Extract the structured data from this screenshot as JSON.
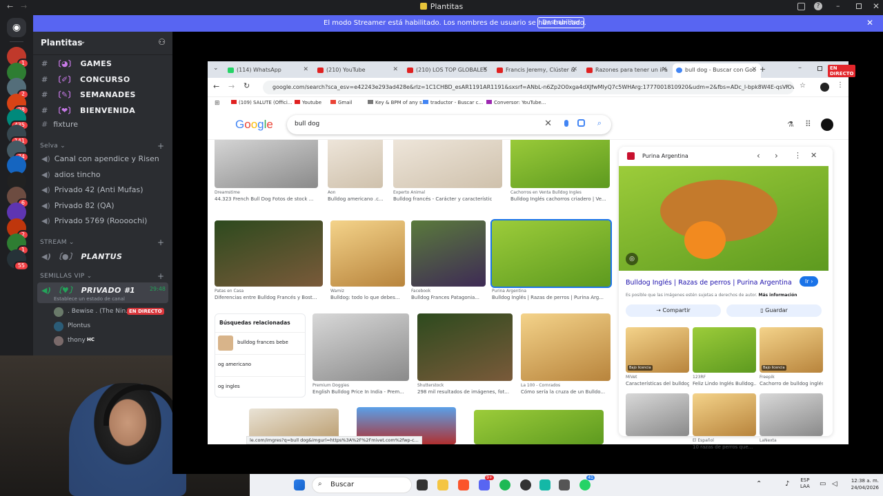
{
  "window": {
    "title": "Plantitas"
  },
  "banner": {
    "text": "El modo Streamer está habilitado. Los nombres de usuario se han truncado.",
    "button": "Deshabilitar"
  },
  "servers": [
    {
      "badge": "1"
    },
    {
      "badge": ""
    },
    {
      "badge": "2"
    },
    {
      "badge": "28"
    },
    {
      "badge": "435"
    },
    {
      "badge": "141"
    },
    {
      "badge": "74"
    },
    {
      "badge": ""
    },
    {
      "badge": ""
    },
    {
      "badge": "6"
    },
    {
      "badge": ""
    },
    {
      "badge": "2"
    },
    {
      "badge": "1"
    },
    {
      "badge": "55"
    }
  ],
  "server_name": "Plantitas",
  "channels": {
    "top": [
      {
        "name": "GAMES"
      },
      {
        "name": "CONCURSO"
      },
      {
        "name": "SEMANADES"
      },
      {
        "name": "BIENVENIDA"
      },
      {
        "name": "fixture"
      }
    ],
    "selva_label": "Selva",
    "selva": [
      {
        "name": "Canal con apendice y Risen"
      },
      {
        "name": "adios tincho"
      },
      {
        "name": "Privado 42 (Anti Mufas)"
      },
      {
        "name": "Privado 82 (QA)"
      },
      {
        "name": "Privado 5769 (Roooochi)"
      }
    ],
    "stream_label": "STREAM",
    "stream": [
      {
        "name": "PLANTUS"
      }
    ],
    "vip_label": "SEMILLAS VIP",
    "voice": {
      "name": "PRIVADO #1",
      "time": "29:48",
      "status": "Establece un estado de canal"
    },
    "users": [
      {
        "name": ". Bewise . (The Nin...",
        "live": "EN DIRECTO"
      },
      {
        "name": "Plontus",
        "live": ""
      },
      {
        "name": "thony",
        "live": "HC"
      }
    ]
  },
  "browser": {
    "tabs": [
      {
        "label": "(114) WhatsApp"
      },
      {
        "label": "(210) YouTube"
      },
      {
        "label": "(210) LOS TOP GLOBALES"
      },
      {
        "label": "Francis Jeremy, Clúster &"
      },
      {
        "label": "Razones para tener un iPa"
      },
      {
        "label": "bull dog - Buscar con Goo"
      }
    ],
    "live_badge": "EN DIRECTO",
    "url": "google.com/search?sca_esv=e42243e293ad428e&rlz=1C1CHBD_esAR1191AR1191&sxsrf=ANbL-n6Zp2O0xga4dXJfwMIyQ7c5WHArg:1777001810920&udm=2&fbs=ADc_l-bpk8W4E-qsVlOvbGJc...",
    "bookmarks": [
      "(109) SALUTE (Offici...",
      "Youtube",
      "Gmail",
      "Key & BPM of any s...",
      "traductor - Buscar c...",
      "Conversor: YouTube..."
    ],
    "status_url": "le.com/imgres?q=bull dog&imgurl=https%3A%2F%2Fmivet.com%2fwp-c..."
  },
  "google": {
    "logo": "Google",
    "query": "bull dog"
  },
  "results": {
    "row1": [
      {
        "src": "Dreamstime",
        "cap": "44.323 French Bull Dog Fotos de stock ..."
      },
      {
        "src": "Aon",
        "cap": "Bulldog americano .c..."
      },
      {
        "src": "Experto Animal",
        "cap": "Bulldog francés - Carácter y característic"
      },
      {
        "src": "Cachorros en Venta Bulldog Ingles",
        "cap": "Bulldog Inglés cachorros criadero | Ve..."
      }
    ],
    "row2": [
      {
        "src": "Patas en Casa",
        "cap": "Diferencias entre Bulldog Francés y Bost..."
      },
      {
        "src": "Wamiz",
        "cap": "Bulldog: todo lo que debes..."
      },
      {
        "src": "Facebook",
        "cap": "Bulldog Frances Patagonia..."
      },
      {
        "src": "Purina Argentina",
        "cap": "Bulldog Inglés | Razas de perros | Purina Arg..."
      }
    ],
    "related_title": "Búsquedas relacionadas",
    "related": [
      "bulldog frances bebe",
      "og americano",
      "og ingles"
    ],
    "row3": [
      {
        "src": "Premium Doggies",
        "cap": "English Bulldog Price In India - Prem..."
      },
      {
        "src": "Shutterstock",
        "cap": "298 mil resultados de imágenes, fot..."
      },
      {
        "src": "La 100 - Cornrados",
        "cap": "Cómo sería la cruza de un Bulldo..."
      }
    ]
  },
  "panel": {
    "source": "Purina Argentina",
    "title": "Bulldog Inglés | Razas de perros | Purina Argentina",
    "go": "Ir",
    "note": "Es posible que las imágenes estén sujetas a derechos de autor.",
    "more": "Más información",
    "share": "Compartir",
    "save": "Guardar",
    "thumbs": [
      {
        "src": "MiVet",
        "cap": "Características del bulldog..."
      },
      {
        "src": "123RF",
        "cap": "Feliz Lindo Inglés Bulldog..."
      },
      {
        "src": "Freepik",
        "cap": "Cachorro de bulldog inglés..."
      },
      {
        "src": "",
        "cap": ""
      },
      {
        "src": "El Español",
        "cap": "10 razas de perros que..."
      },
      {
        "src": "LaNexta",
        "cap": ""
      }
    ],
    "license": "Bajo licencia"
  },
  "taskbar": {
    "search": "Buscar",
    "lang": "ESP",
    "lang2": "LAA",
    "time": "12:38 a. m.",
    "date": "24/04/2026",
    "badge1": "9+",
    "badge2": "41"
  }
}
